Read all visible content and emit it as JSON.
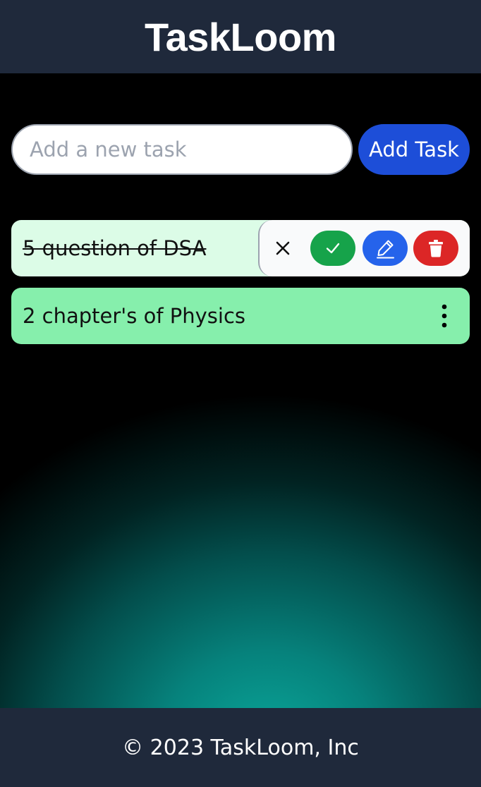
{
  "app": {
    "title": "TaskLoom"
  },
  "form": {
    "input_value": "",
    "input_placeholder": "Add a new task",
    "add_button_label": "Add Task"
  },
  "tasks": [
    {
      "text": "5 question of DSA",
      "completed": true,
      "actions_open": true,
      "actions": {
        "close_icon": "close-icon",
        "complete_icon": "check-icon",
        "edit_icon": "pencil-icon",
        "delete_icon": "trash-icon"
      }
    },
    {
      "text": "2 chapter's of Physics",
      "completed": false,
      "actions_open": false,
      "menu_icon": "kebab-menu-icon"
    }
  ],
  "footer": {
    "text": "© 2023 TaskLoom, Inc"
  },
  "colors": {
    "header_bg": "#1f293b",
    "add_button": "#1d4ed8",
    "completed_task_bg": "#dcfce7",
    "pending_task_bg": "#86efac",
    "complete_button": "#16a34a",
    "edit_button": "#2563eb",
    "delete_button": "#dc2626",
    "background_glow": "#0aa89b"
  }
}
